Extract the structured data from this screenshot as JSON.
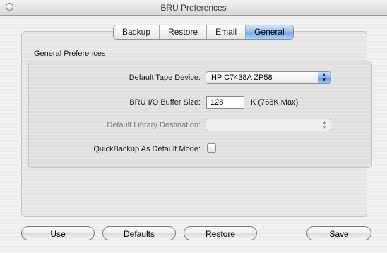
{
  "window": {
    "title": "BRU Preferences"
  },
  "tabs": [
    {
      "label": "Backup"
    },
    {
      "label": "Restore"
    },
    {
      "label": "Email"
    },
    {
      "label": "General",
      "active": true
    }
  ],
  "group": {
    "title": "General Preferences",
    "default_tape_device": {
      "label": "Default Tape Device:",
      "value": "HP C7438A ZP58"
    },
    "buffer_size": {
      "label": "BRU I/O Buffer Size:",
      "value": "128",
      "suffix": "K (768K Max)"
    },
    "library_destination": {
      "label": "Default Library Destination:",
      "value": "",
      "enabled": false
    },
    "quickbackup": {
      "label": "QuickBackup As Default Mode:",
      "checked": false
    }
  },
  "buttons": {
    "use": "Use",
    "defaults": "Defaults",
    "restore": "Restore",
    "save": "Save"
  },
  "colors": {
    "accent_blue": "#6fa8e8",
    "window_bg": "#ececec"
  },
  "icons": {
    "popup_arrows": "up-down-arrows-icon",
    "close": "close-icon"
  }
}
